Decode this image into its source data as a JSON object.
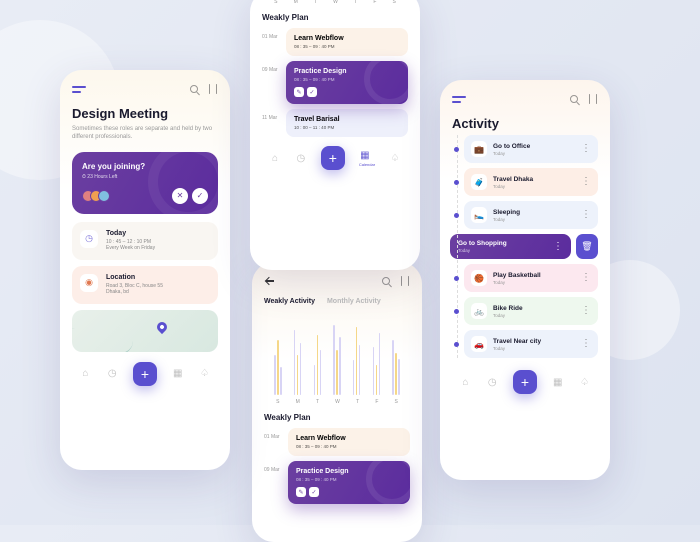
{
  "colors": {
    "accent": "#5a4fcf",
    "purple": "#6b3fa0"
  },
  "screen1": {
    "title": "Design Meeting",
    "subtitle": "Sometimes these roles are separate and held by two different professionals.",
    "join": {
      "q": "Are you joining?",
      "time": "⏱ 23 Hours Left"
    },
    "today": {
      "label": "Today",
      "time": "10 : 45 – 12 : 10 PM",
      "repeat": "Every Week on Friday"
    },
    "location": {
      "label": "Location",
      "addr": "Road 3, Bloc C, house 55",
      "city": "Dhaka, bd"
    }
  },
  "plan": {
    "heading": "Weakly Plan",
    "items": [
      {
        "date": "01 Mar",
        "title": "Learn Webflow",
        "time": "08 : 35 – 09 : 40 PM"
      },
      {
        "date": "09 Mar",
        "title": "Practice Design",
        "time": "08 : 35 – 09 : 40 PM"
      },
      {
        "date": "11 Mar",
        "title": "Travel Barisal",
        "time": "10 : 00 – 11 : 40 PM"
      }
    ],
    "navActive": "Calendar"
  },
  "activityChart": {
    "tabs": [
      "Weakly Activity",
      "Monthly Activity"
    ],
    "days": [
      "S",
      "M",
      "T",
      "W",
      "T",
      "F",
      "S"
    ]
  },
  "chart_data": {
    "type": "bar",
    "categories": [
      "S",
      "M",
      "T",
      "W",
      "T",
      "F",
      "S"
    ],
    "series": [
      {
        "name": "series-a",
        "values": [
          40,
          65,
          30,
          70,
          35,
          48,
          55
        ]
      },
      {
        "name": "series-b",
        "values": [
          55,
          40,
          60,
          45,
          68,
          30,
          42
        ]
      },
      {
        "name": "series-c",
        "values": [
          28,
          52,
          45,
          58,
          50,
          62,
          36
        ]
      }
    ],
    "title": "Weakly Activity",
    "ylim": [
      0,
      80
    ]
  },
  "activity": {
    "title": "Activity",
    "items": [
      {
        "icon": "💼",
        "title": "Go to Office",
        "sub": "Today",
        "cls": "c-blue"
      },
      {
        "icon": "🧳",
        "title": "Travel Dhaka",
        "sub": "Today",
        "cls": "c-or"
      },
      {
        "icon": "🛌",
        "title": "Sleeping",
        "sub": "Today",
        "cls": "c-blue"
      },
      {
        "icon": "🛍",
        "title": "Go to Shopping",
        "sub": "Today",
        "swipe": true
      },
      {
        "icon": "🏀",
        "title": "Play Basketball",
        "sub": "Today",
        "cls": "c-pk"
      },
      {
        "icon": "🚲",
        "title": "Bike Ride",
        "sub": "Today",
        "cls": "c-gr"
      },
      {
        "icon": "🚗",
        "title": "Travel Near city",
        "sub": "Today",
        "cls": "c-blue"
      }
    ]
  }
}
